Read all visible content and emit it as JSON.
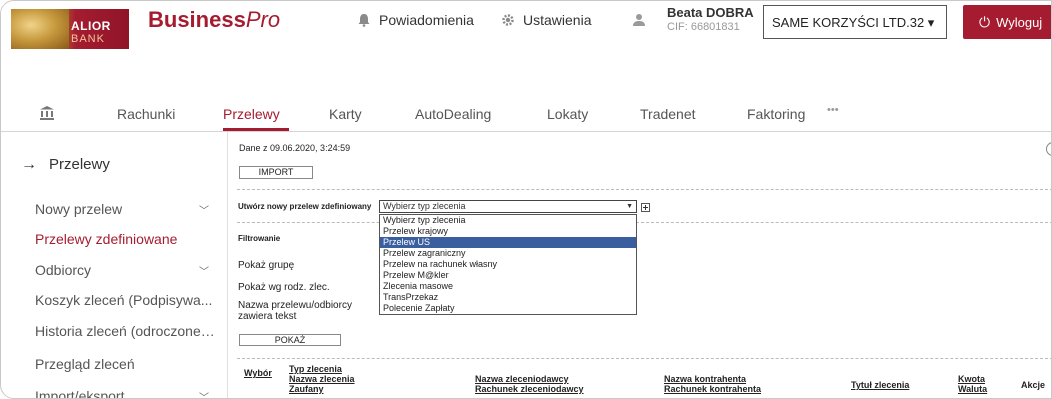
{
  "header": {
    "logo_line1": "ALIOR",
    "logo_line2": "BANK",
    "brand_bold": "Business",
    "brand_italic": "Pro",
    "notifications_label": "Powiadomienia",
    "settings_label": "Ustawienia",
    "user_name": "Beata DOBRA",
    "user_cif": "CIF: 66801831",
    "company_label": "SAME KORZYŚCI LTD.32 ▾",
    "logout_label": "Wyloguj"
  },
  "nav": {
    "items": [
      "Rachunki",
      "Przelewy",
      "Karty",
      "AutoDealing",
      "Lokaty",
      "Tradenet",
      "Faktoring",
      "•••"
    ],
    "active": "Przelewy"
  },
  "sidebar": {
    "title": "Przelewy",
    "items": [
      {
        "label": "Nowy przelew",
        "expandable": true
      },
      {
        "label": "Przelewy zdefiniowane",
        "expandable": false,
        "active": true
      },
      {
        "label": "Odbiorcy",
        "expandable": true
      },
      {
        "label": "Koszyk zleceń (Podpisywa...",
        "expandable": false
      },
      {
        "label": "Historia zleceń (odroczone,...",
        "expandable": false
      },
      {
        "label": "Przegląd zleceń",
        "expandable": false
      },
      {
        "label": "Import/eksport",
        "expandable": true
      }
    ]
  },
  "main": {
    "data_date": "Dane z 09.06.2020, 3:24:59",
    "import_button": "IMPORT",
    "create_label": "Utwórz nowy przelew zdefiniowany",
    "select_value": "Wybierz typ zlecenia",
    "dropdown_options": [
      "Wybierz typ zlecenia",
      "Przelew krajowy",
      "Przelew US",
      "Przelew zagraniczny",
      "Przelew na rachunek własny",
      "Przelew M@kler",
      "Zlecenia masowe",
      "TransPrzekaz",
      "Polecenie Zapłaty"
    ],
    "dropdown_selected": "Przelew US",
    "filter_title": "Filtrowanie",
    "filter_group": "Pokaż grupę",
    "filter_type": "Pokaż wg rodz. zlec.",
    "filter_name_line1": "Nazwa przelewu/odbiorcy",
    "filter_name_line2": "zawiera tekst",
    "show_button": "POKAŻ",
    "table_headers": {
      "wybor": "Wybór",
      "typ": "Typ zlecenia",
      "nazwa": "Nazwa zlecenia",
      "zaufany": "Zaufany",
      "zleceniodawca": "Nazwa zleceniodawcy",
      "rach_zlec": "Rachunek zleceniodawcy",
      "kontrahent": "Nazwa kontrahenta",
      "rach_kontr": "Rachunek kontrahenta",
      "tytul": "Tytuł zlecenia",
      "kwota": "Kwota",
      "waluta": "Waluta",
      "akcje": "Akcje"
    }
  }
}
